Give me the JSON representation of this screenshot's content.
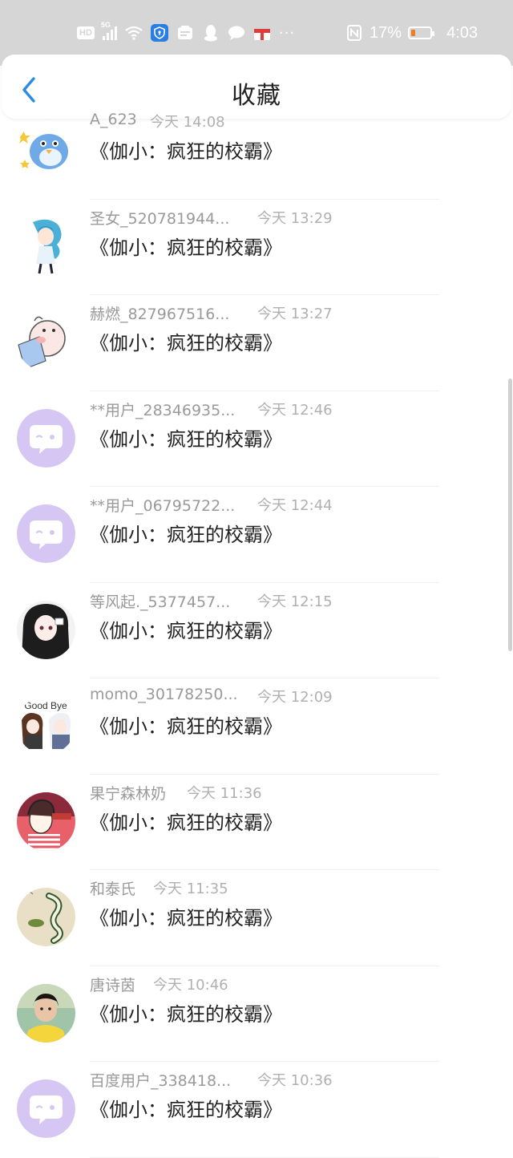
{
  "status_bar": {
    "hd": "HD",
    "net": "5G",
    "battery_percent": "17%",
    "time": "4:03",
    "more": "···",
    "battery_level": 0.17,
    "icons": [
      "hd-icon",
      "signal-icon",
      "wifi-icon",
      "security-shield-icon",
      "app-icon",
      "qq-icon",
      "chat-icon",
      "gift-icon",
      "more-icon",
      "nfc-icon",
      "battery-icon"
    ]
  },
  "header": {
    "title": "收藏",
    "back_icon": "chevron-left-icon",
    "accent": "#2a8ce0"
  },
  "items": [
    {
      "name": "A_623",
      "time": "今天 14:08",
      "msg": "《伽小：疯狂的校霸》",
      "avatar": "cartoon-bird"
    },
    {
      "name": "圣女_520781944...",
      "time": "今天 13:29",
      "msg": "《伽小：疯狂的校霸》",
      "avatar": "anime-girl-blue"
    },
    {
      "name": "赫燃_827967516...",
      "time": "今天 13:27",
      "msg": "《伽小：疯狂的校霸》",
      "avatar": "cartoon-pig"
    },
    {
      "name": "**用户_28346935...",
      "time": "今天 12:46",
      "msg": "《伽小：疯狂的校霸》",
      "avatar": "default"
    },
    {
      "name": "**用户_06795722...",
      "time": "今天 12:44",
      "msg": "《伽小：疯狂的校霸》",
      "avatar": "default"
    },
    {
      "name": "等风起._5377457...",
      "time": "今天 12:15",
      "msg": "《伽小：疯狂的校霸》",
      "avatar": "anime-dark-hair"
    },
    {
      "name": "momo_30178250...",
      "time": "今天 12:09",
      "msg": "《伽小：疯狂的校霸》",
      "avatar": "good-bye"
    },
    {
      "name": "果宁森林奶",
      "time": "今天 11:36",
      "msg": "《伽小：疯狂的校霸》",
      "avatar": "drawing-girl"
    },
    {
      "name": "和泰氏",
      "time": "今天 11:35",
      "msg": "《伽小：疯狂的校霸》",
      "avatar": "snake-drawing"
    },
    {
      "name": "唐诗茵",
      "time": "今天 10:46",
      "msg": "《伽小：疯狂的校霸》",
      "avatar": "photo-child"
    },
    {
      "name": "百度用户_338418...",
      "time": "今天 10:36",
      "msg": "《伽小：疯狂的校霸》",
      "avatar": "default"
    }
  ],
  "colors": {
    "default_avatar": "#d6c6f3",
    "name_text": "#9a9a9a",
    "time_text": "#b0b0b0"
  },
  "avatar_labels": {
    "good_bye": "Good Bye"
  }
}
